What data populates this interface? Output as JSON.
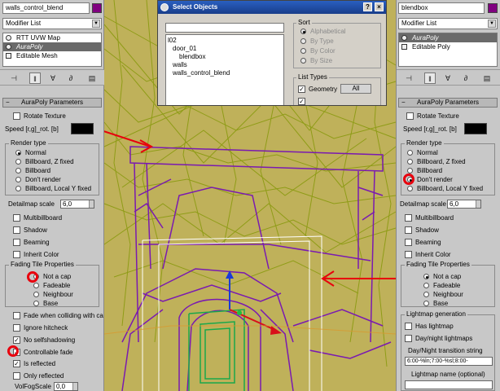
{
  "left_panel": {
    "object_name": "walls_control_blend",
    "color": "#800080",
    "modifier_list": "Modifier List",
    "stack": [
      "RTT UVW Map",
      "AuraPoly",
      "Editable Mesh"
    ],
    "toolbar_icons": [
      "pin-stack-icon",
      "show-end-result-icon",
      "make-unique-icon",
      "remove-modifier-icon",
      "configure-sets-icon"
    ],
    "rollout_title": "AuraPoly Parameters",
    "rotate_texture": "Rotate Texture",
    "speed_label": "Speed [r,g]_rot. [b]",
    "render_type_title": "Render type",
    "render_types": [
      "Normal",
      "Billboard, Z fixed",
      "Billboard",
      "Don't render",
      "Billboard, Local Y fixed"
    ],
    "detailmap_label": "Detailmap scale",
    "detailmap_value": "6,0",
    "checkboxes_a": [
      "Multibillboard",
      "Shadow",
      "Beaming",
      "Inherit Color"
    ],
    "fading_title": "Fading Tile Properties",
    "fading_options": [
      "Not a cap",
      "Fadeable",
      "Neighbour",
      "Base"
    ],
    "checkboxes_b": [
      {
        "label": "Fade when colliding with ca",
        "checked": false
      },
      {
        "label": "Ignore hitcheck",
        "checked": false
      },
      {
        "label": "No selfshadowing",
        "checked": true
      },
      {
        "label": "Controllable fade",
        "checked": true
      },
      {
        "label": "Is reflected",
        "checked": true
      },
      {
        "label": "Only reflected",
        "checked": false
      }
    ],
    "volfog_label": "VolFogScale",
    "volfog_value": "0,0"
  },
  "right_panel": {
    "object_name": "blendbox",
    "color": "#800080",
    "modifier_list": "Modifier List",
    "stack": [
      "AuraPoly",
      "Editable Poly"
    ],
    "toolbar_icons": [
      "pin-stack-icon",
      "show-end-result-icon",
      "make-unique-icon",
      "remove-modifier-icon",
      "configure-sets-icon"
    ],
    "rollout_title": "AuraPoly Parameters",
    "rotate_texture": "Rotate Texture",
    "speed_label": "Speed [r,g]_rot. [b]",
    "render_type_title": "Render type",
    "render_types": [
      "Normal",
      "Billboard, Z fixed",
      "Billboard",
      "Don't render",
      "Billboard, Local Y fixed"
    ],
    "detailmap_label": "Detailmap scale",
    "detailmap_value": "6,0",
    "checkboxes_a": [
      "Multibillboard",
      "Shadow",
      "Beaming",
      "Inherit Color"
    ],
    "fading_title": "Fading Tile Properties",
    "fading_options": [
      "Not a cap",
      "Fadeable",
      "Neighbour",
      "Base"
    ],
    "lightmap_title": "Lightmap generation",
    "has_lightmap": "Has lightmap",
    "daynight_lightmaps": "Day/night lightmaps",
    "transition_label": "Day/Night transition string",
    "transition_value": "6:00-%ln;7:00-%sl;8:00-",
    "lightmap_name_label": "Lightmap name (optional)"
  },
  "dialog": {
    "title": "Select Objects",
    "help_btn": "?",
    "close_btn": "×",
    "objects": [
      "l02",
      "door_01",
      "blendbox",
      "walls",
      "walls_control_blend"
    ],
    "sort_title": "Sort",
    "sort_options": [
      "Alphabetical",
      "By Type",
      "By Color",
      "By Size"
    ],
    "list_types_title": "List Types",
    "geometry_label": "Geometry",
    "all_btn": "All"
  }
}
